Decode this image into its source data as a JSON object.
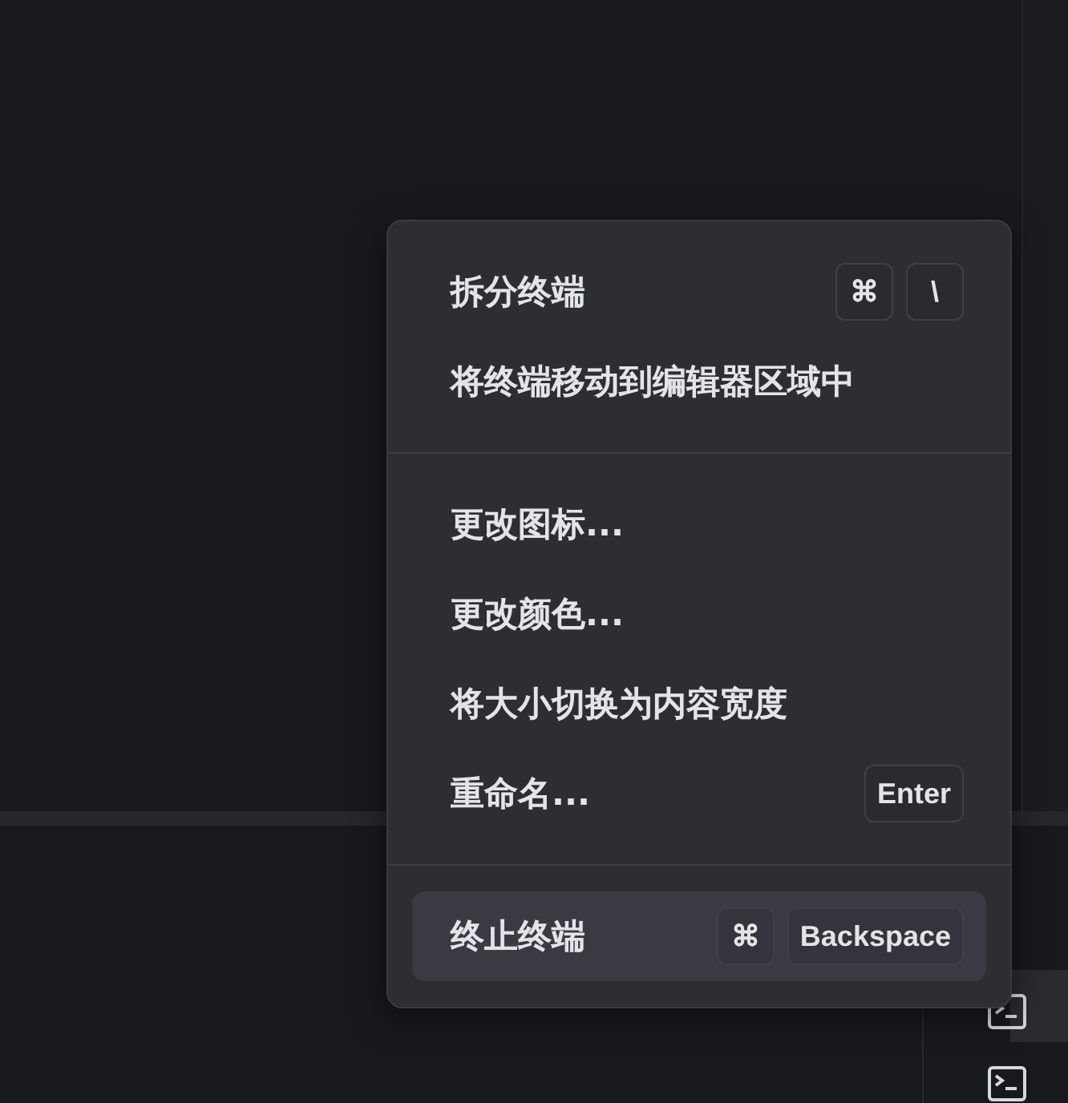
{
  "context_menu": {
    "groups": [
      {
        "items": [
          {
            "label": "拆分终端",
            "keys": [
              "⌘",
              "\\"
            ],
            "selected": false
          },
          {
            "label": "将终端移动到编辑器区域中",
            "selected": false
          }
        ]
      },
      {
        "items": [
          {
            "label": "更改图标...",
            "selected": false
          },
          {
            "label": "更改颜色...",
            "selected": false
          },
          {
            "label": "将大小切换为内容宽度",
            "selected": false
          },
          {
            "label": "重命名...",
            "keys": [
              "Enter"
            ],
            "selected": false
          }
        ]
      },
      {
        "items": [
          {
            "label": "终止终端",
            "keys": [
              "⌘",
              "Backspace"
            ],
            "selected": true
          }
        ]
      }
    ]
  }
}
